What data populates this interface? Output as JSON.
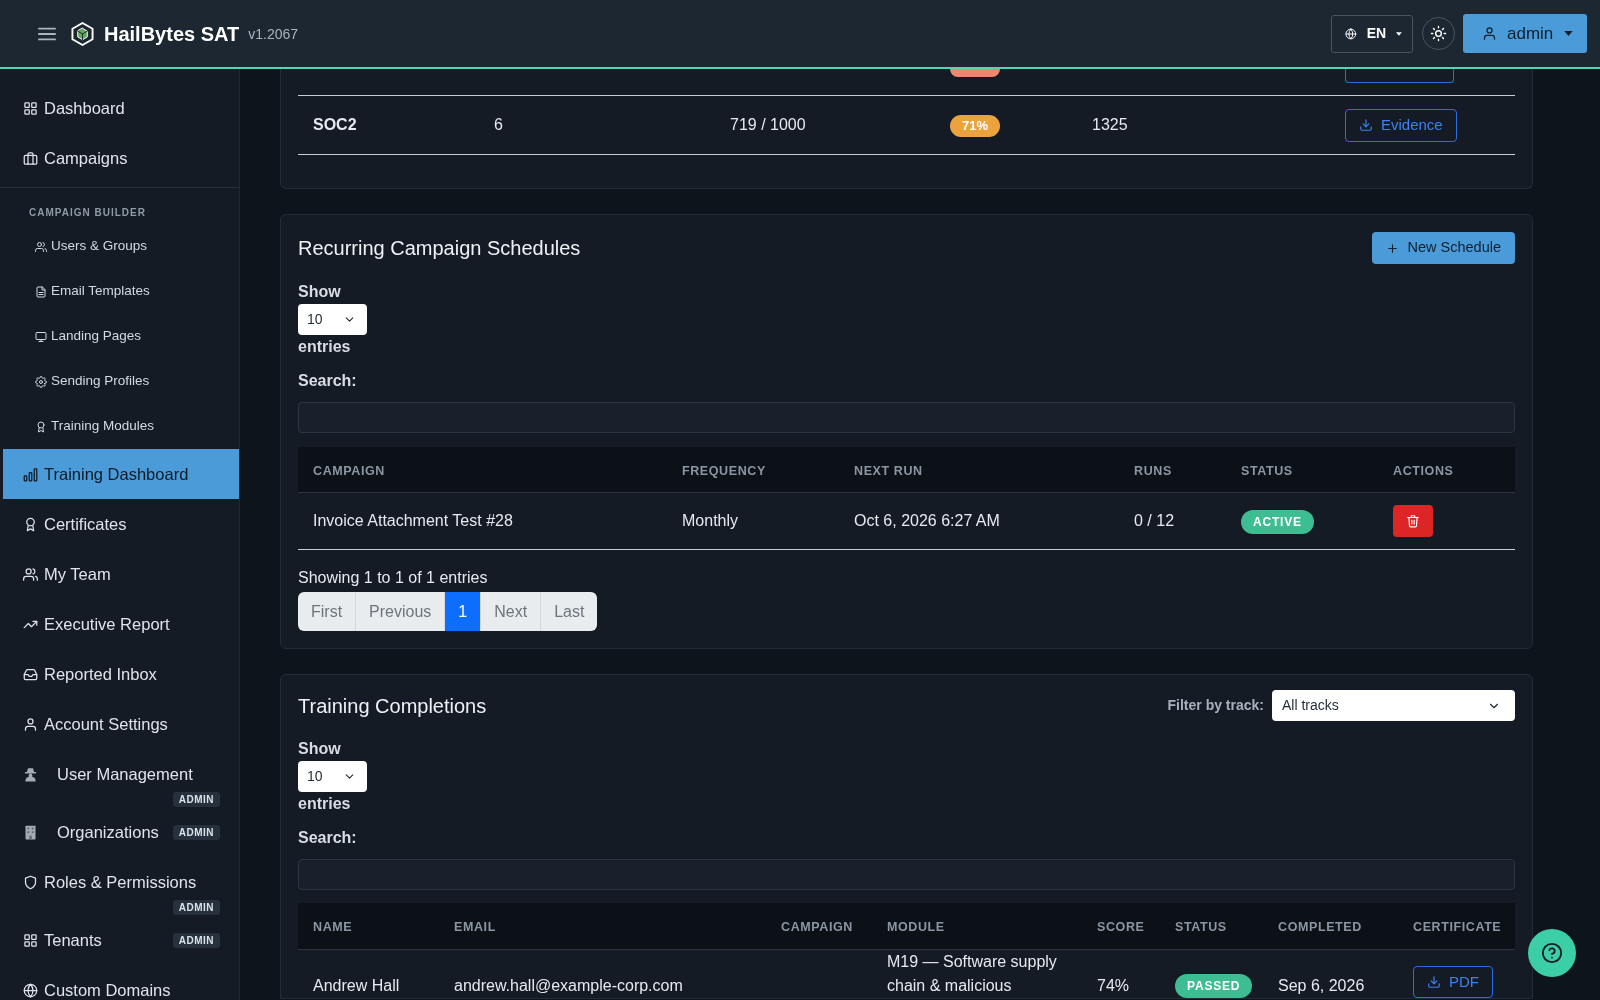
{
  "header": {
    "title": "HailBytes SAT",
    "version": "v1.2067",
    "language": "EN",
    "user": "admin"
  },
  "sidebar": {
    "sections": [
      {
        "items": [
          {
            "label": "Dashboard",
            "selected": false
          },
          {
            "label": "Campaigns",
            "selected": false
          }
        ]
      },
      {
        "heading": "CAMPAIGN BUILDER",
        "items": [
          {
            "label": "Users & Groups",
            "selected": false
          },
          {
            "label": "Email Templates",
            "selected": false
          },
          {
            "label": "Landing Pages",
            "selected": false
          },
          {
            "label": "Sending Profiles",
            "selected": false
          },
          {
            "label": "Training Modules",
            "selected": false
          }
        ]
      },
      {
        "items": [
          {
            "label": "Training Dashboard",
            "selected": true
          },
          {
            "label": "Certificates",
            "selected": false
          },
          {
            "label": "My Team",
            "selected": false
          },
          {
            "label": "Executive Report",
            "selected": false
          },
          {
            "label": "Reported Inbox",
            "selected": false
          },
          {
            "label": "Account Settings",
            "selected": false
          },
          {
            "label": "User Management",
            "selected": false,
            "badge": "ADMIN"
          },
          {
            "label": "Organizations",
            "selected": false,
            "badge": "ADMIN"
          },
          {
            "label": "Roles & Permissions",
            "selected": false,
            "badge": "ADMIN"
          },
          {
            "label": "Tenants",
            "selected": false,
            "badge": "ADMIN"
          },
          {
            "label": "Custom Domains",
            "selected": false
          }
        ]
      }
    ]
  },
  "compliance_table": {
    "rows": [
      {
        "kind": "clipped",
        "column_4": {
          "color": "#f08572"
        }
      },
      {
        "kind": "full",
        "column_1": "SOC2",
        "column_2": "6",
        "column_3": "719 / 1000",
        "column_4": {
          "text": "71%",
          "color": "#eca33e"
        },
        "column_5": "1325",
        "action": "Evidence"
      }
    ]
  },
  "schedules": {
    "title": "Recurring Campaign Schedules",
    "new_button": "New Schedule",
    "show_label": "Show",
    "page_length": "10",
    "entries_label": "entries",
    "search_label": "Search:",
    "columns": [
      "CAMPAIGN",
      "FREQUENCY",
      "NEXT RUN",
      "RUNS",
      "STATUS",
      "ACTIONS"
    ],
    "rows": [
      {
        "campaign": "Invoice Attachment Test #28",
        "frequency": "Monthly",
        "next_run": "Oct 6, 2026 6:27 AM",
        "runs": "0 / 12",
        "status": {
          "text": "ACTIVE",
          "color": "#3ebd93"
        }
      }
    ],
    "info": "Showing 1 to 1 of 1 entries",
    "pagination": [
      {
        "label": "First",
        "selected": false
      },
      {
        "label": "Previous",
        "selected": false
      },
      {
        "label": "1",
        "selected": true
      },
      {
        "label": "Next",
        "selected": false
      },
      {
        "label": "Last",
        "selected": false
      }
    ]
  },
  "completions": {
    "title": "Training Completions",
    "filter": {
      "label": "Filter by track:",
      "value": "All tracks"
    },
    "show_label": "Show",
    "page_length": "10",
    "entries_label": "entries",
    "search_label": "Search:",
    "columns": [
      "NAME",
      "EMAIL",
      "CAMPAIGN",
      "MODULE",
      "SCORE",
      "STATUS",
      "COMPLETED",
      "CERTIFICATE"
    ],
    "rows": [
      {
        "name": "Andrew Hall",
        "email": "andrew.hall@example-corp.com",
        "module": "M19 — Software supply chain & malicious",
        "score": "74%",
        "status": {
          "text": "PASSED",
          "color": "#3ebd93"
        },
        "completed": "Sep 6, 2026",
        "certificate": "PDF"
      }
    ]
  }
}
